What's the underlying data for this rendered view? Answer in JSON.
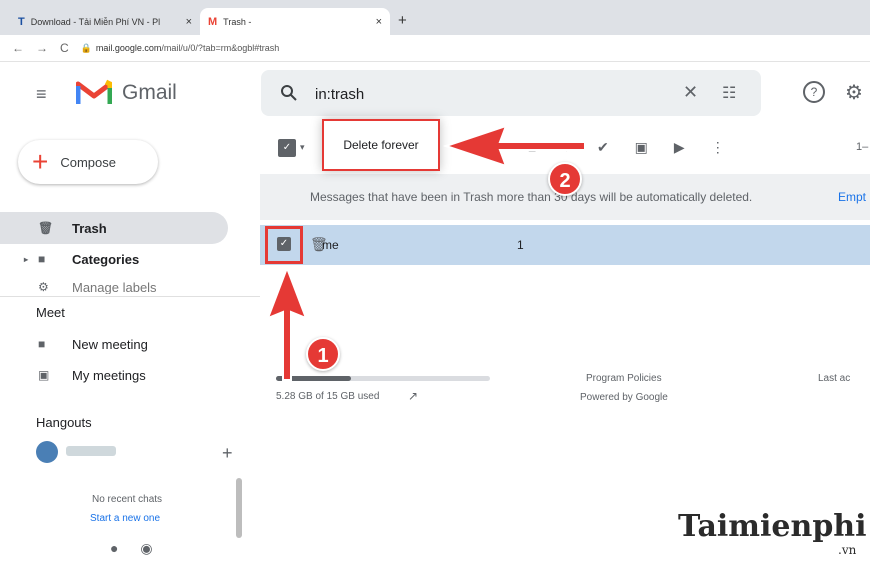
{
  "browser": {
    "tabs": [
      {
        "favicon": "T",
        "title": "Download - Tải Miễn Phí VN - Pl"
      },
      {
        "favicon": "M",
        "title": "Trash - "
      }
    ],
    "tab_close": "×",
    "new_tab": "+",
    "nav": {
      "back": "←",
      "forward": "→",
      "reload": "C",
      "lock": "🔒"
    },
    "url_host": "mail.google.com",
    "url_path": "/mail/u/0/?tab=rm&ogbl#trash"
  },
  "header": {
    "app_name": "Gmail",
    "search_query": "in:trash",
    "clear_icon": "✕",
    "options_icon": "☷",
    "help_icon": "?",
    "settings_icon": "⚙"
  },
  "sidebar": {
    "compose_label": "Compose",
    "items": [
      {
        "label": "Trash",
        "icon": "trash-icon"
      },
      {
        "label": "Categories",
        "icon": "label-icon"
      },
      {
        "label": "Manage labels",
        "icon": "gear-icon"
      }
    ],
    "meet": {
      "heading": "Meet",
      "items": [
        {
          "label": "New meeting",
          "icon": "video-icon"
        },
        {
          "label": "My meetings",
          "icon": "calendar-icon"
        }
      ]
    },
    "hangouts": {
      "heading": "Hangouts",
      "add": "+",
      "no_recent": "No recent chats",
      "start_new": "Start a new one"
    }
  },
  "toolbar": {
    "delete_forever_label": "Delete forever",
    "page_count": "1–"
  },
  "banner": {
    "text": "Messages that have been in Trash more than 30 days will be automatically deleted.",
    "link": "Empt"
  },
  "messages": [
    {
      "sender": "me",
      "count": "1",
      "selected": true
    }
  ],
  "footer": {
    "storage": "5.28 GB of 15 GB used",
    "storage_fraction": 0.352,
    "program_policies": "Program Policies",
    "powered_by": "Powered by Google",
    "last_activity": "Last ac"
  },
  "annotations": {
    "step1": "1",
    "step2": "2",
    "accent": "#e53935"
  },
  "watermark": {
    "brand": "Taimienphi",
    "suffix": ".vn"
  }
}
